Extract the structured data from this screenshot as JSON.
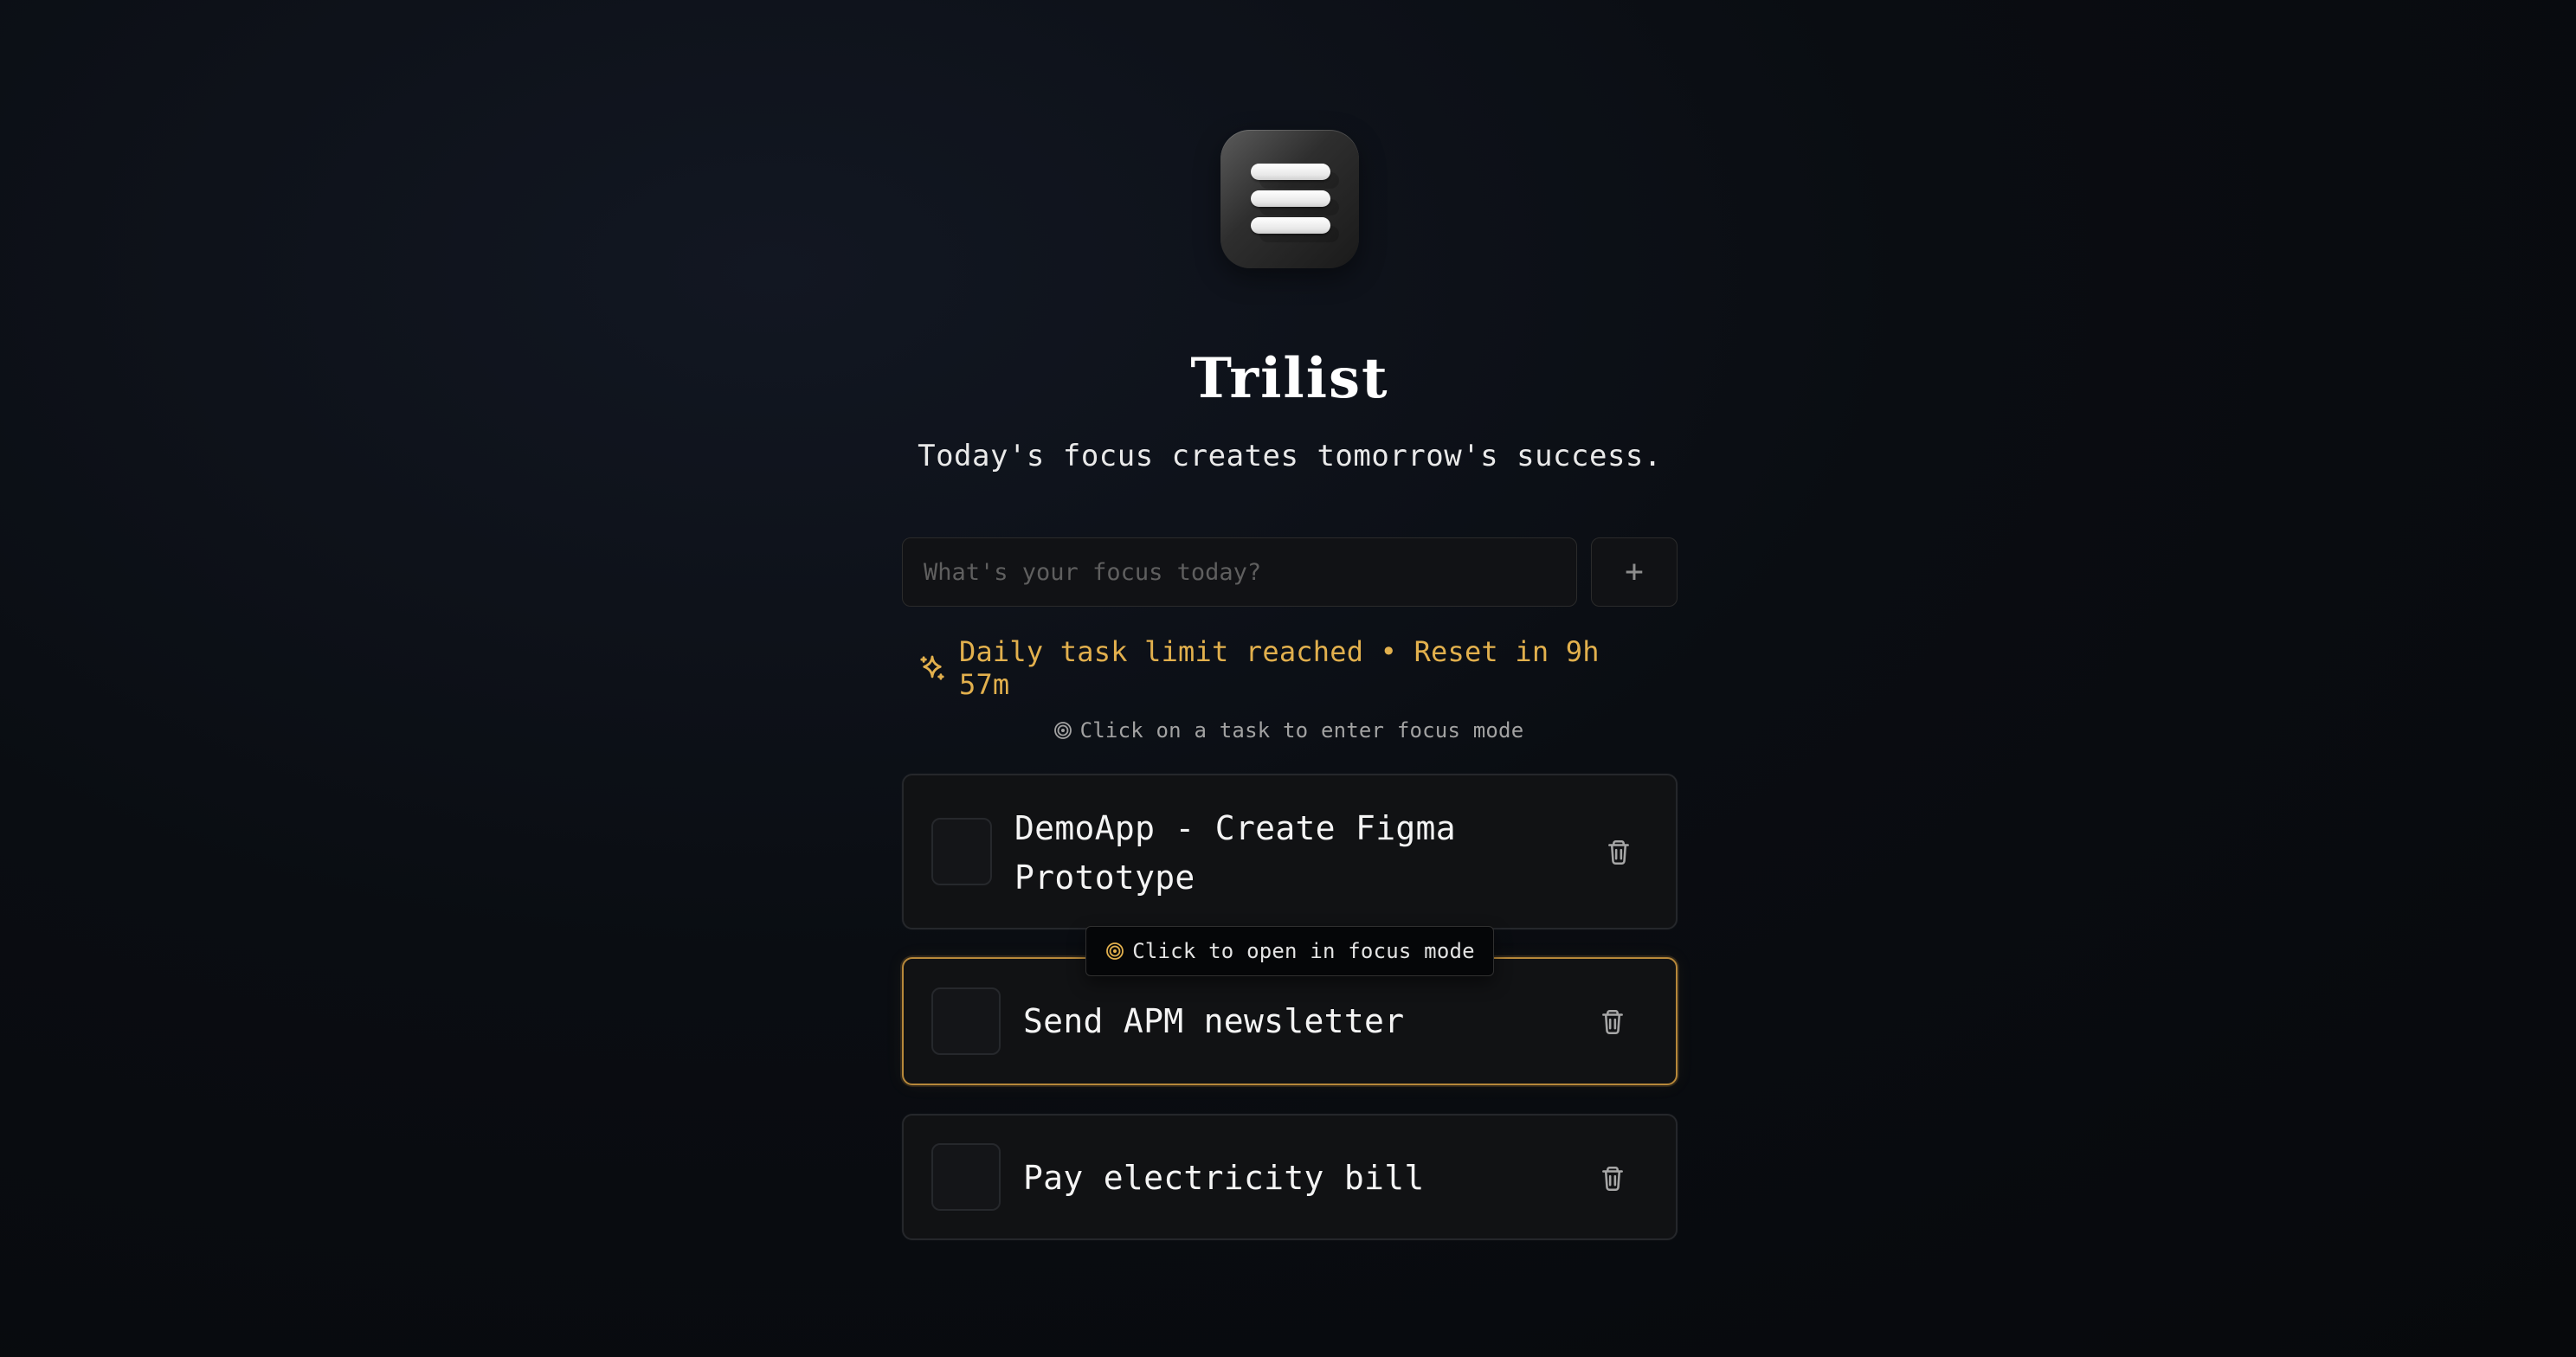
{
  "app": {
    "name": "Trilist",
    "tagline": "Today's focus creates tomorrow's success."
  },
  "input": {
    "placeholder": "What's your focus today?",
    "value": ""
  },
  "actions": {
    "add_button_label": "+"
  },
  "status": {
    "limit_message": "Daily task limit reached • Reset in 9h 57m",
    "focus_hint": "Click on a task to enter focus mode"
  },
  "tooltip": {
    "text": "Click to open in focus mode"
  },
  "tasks": [
    {
      "label": "DemoApp - Create Figma Prototype",
      "state": "default"
    },
    {
      "label": "Send APM newsletter",
      "state": "hovered"
    },
    {
      "label": "Pay electricity bill",
      "state": "default"
    }
  ],
  "icons": {
    "logo": "list-icon",
    "limit": "sparkle-icon",
    "focus": "target-icon",
    "delete": "trash-icon"
  },
  "colors": {
    "background": "#07090c",
    "panel": "#111214",
    "accent": "#e2b04d",
    "hover_border": "#b7883a",
    "text": "#f4f4f4",
    "muted": "#a2a2a2"
  }
}
